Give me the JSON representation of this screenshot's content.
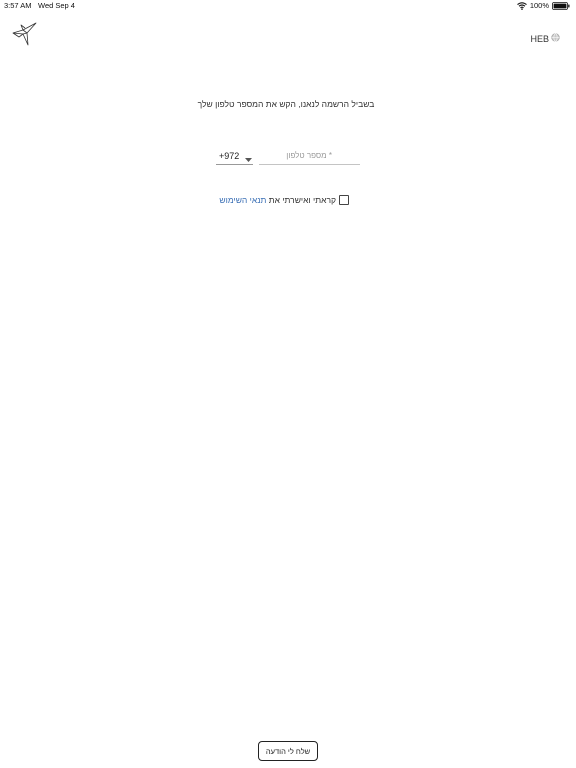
{
  "status_bar": {
    "time": "3:57 AM",
    "date": "Wed Sep 4",
    "battery_percent": "100%",
    "wifi_icon": "wifi-icon",
    "battery_icon": "battery-icon"
  },
  "header": {
    "logo_icon": "origami-bird-logo",
    "language_label": "HEB",
    "language_icon": "globe-icon"
  },
  "registration": {
    "instruction": "בשביל הרשמה לנאנו, הקש את המספר טלפון שלך",
    "country_code": "+972",
    "country_dropdown_icon": "caret-down-icon",
    "phone_placeholder": "* מספר טלפון",
    "phone_value": "",
    "terms_prefix": "קראתי ואישרתי את ",
    "terms_link": "תנאי השימוש",
    "terms_checked": false
  },
  "footer": {
    "send_button_label": "שלח לי הודעה"
  }
}
